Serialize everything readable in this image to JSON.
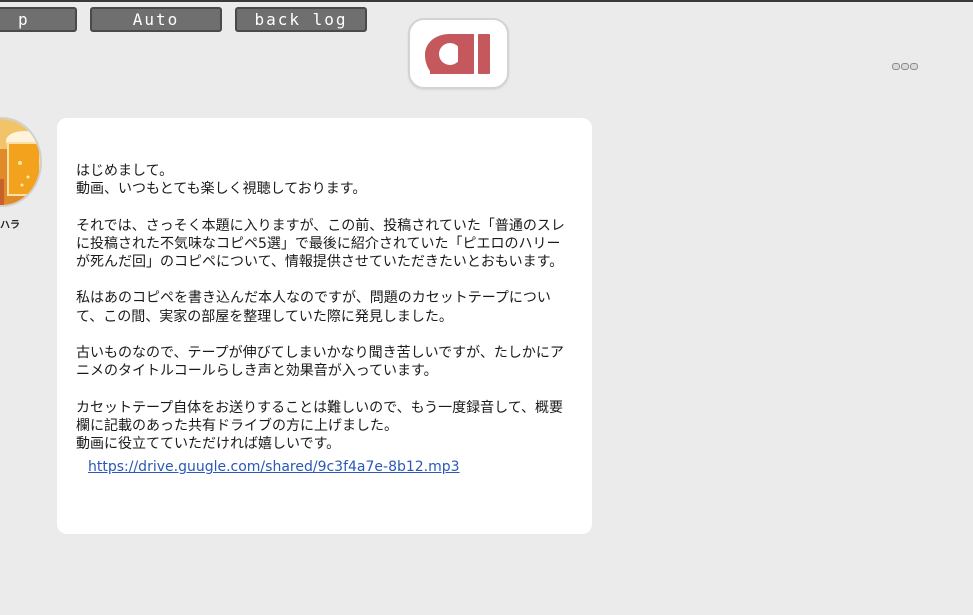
{
  "toolbar": {
    "skip_label": "p",
    "auto_label": "Auto",
    "backlog_label": "back log"
  },
  "logo": {
    "primary_color": "#c4585d"
  },
  "sender": {
    "name": "ハラ"
  },
  "message": {
    "paragraphs": [
      "はじめまして。\n動画、いつもとても楽しく視聴しております。",
      "それでは、さっそく本題に入りますが、この前、投稿されていた「普通のスレに投稿された不気味なコピペ5選」で最後に紹介されていた「ピエロのハリーが死んだ回」のコピペについて、情報提供させていただきたいとおもいます。",
      "私はあのコピペを書き込んだ本人なのですが、問題のカセットテープについて、この間、実家の部屋を整理していた際に発見しました。",
      "古いものなので、テープが伸びてしまいかなり聞き苦しいですが、たしかにアニメのタイトルコールらしき声と効果音が入っています。",
      "カセットテープ自体をお送りすることは難しいので、もう一度録音して、概要欄に記載のあった共有ドライブの方に上げました。\n動画に役立てていただければ嬉しいです。"
    ],
    "link": "https://drive.guugle.com/shared/9c3f4a7e-8b12.mp3"
  },
  "colors": {
    "background": "#ebebeb",
    "button_fill": "#6f6f6f",
    "link": "#2a58b8"
  },
  "icons": {
    "logo": "ghost-pause-logo-icon",
    "menu": "more-dots-icon",
    "avatar": "beer-avatar-icon"
  }
}
